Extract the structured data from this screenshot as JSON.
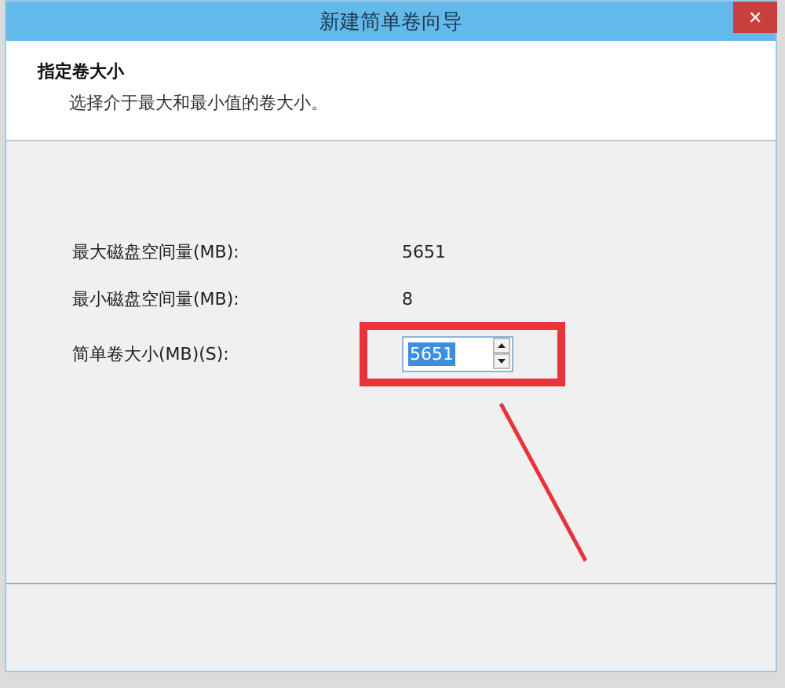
{
  "window": {
    "title": "新建简单卷向导",
    "close": "✕"
  },
  "header": {
    "title": "指定卷大小",
    "subtitle": "选择介于最大和最小值的卷大小。"
  },
  "rows": [
    {
      "kind": "value",
      "label": "最大磁盘空间量(MB):",
      "value": "5651"
    },
    {
      "kind": "value",
      "label": "最小磁盘空间量(MB):",
      "value": "8"
    },
    {
      "kind": "spinner",
      "label": "简单卷大小(MB)(S):",
      "value": "5651",
      "value_selected": true
    }
  ]
}
